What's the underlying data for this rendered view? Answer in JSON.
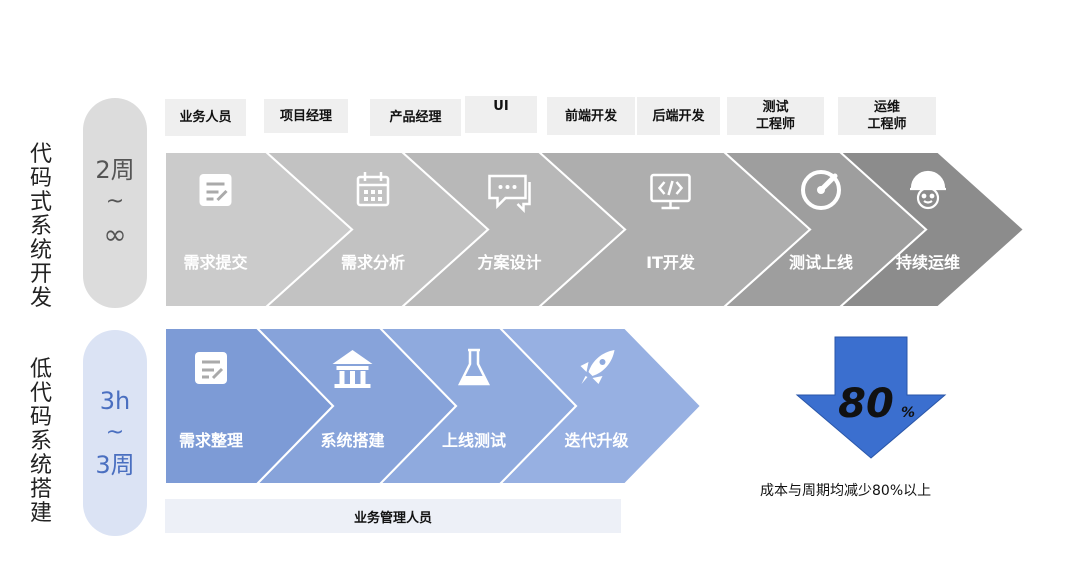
{
  "code_dev": {
    "label": "代码式系统开发",
    "period": {
      "top": "2周",
      "mid": "~",
      "bottom": "∞"
    },
    "roles": [
      "业务人员",
      "项目经理",
      "产品经理",
      "UI",
      "前端开发",
      "后端开发",
      "测试\n工程师",
      "运维\n工程师"
    ],
    "steps": [
      {
        "label": "需求提交",
        "icon": "form-icon",
        "color": "#cbcbcb"
      },
      {
        "label": "需求分析",
        "icon": "calendar-icon",
        "color": "#c2c2c2"
      },
      {
        "label": "方案设计",
        "icon": "chat-icon",
        "color": "#b8b8b8"
      },
      {
        "label": "IT开发",
        "icon": "code-monitor-icon",
        "color": "#aeaeae"
      },
      {
        "label": "测试上线",
        "icon": "gauge-icon",
        "color": "#9e9e9e"
      },
      {
        "label": "持续运维",
        "icon": "worker-helmet-icon",
        "color": "#8c8c8c"
      }
    ]
  },
  "lowcode": {
    "label": "低代码系统搭建",
    "period": {
      "top": "3h",
      "mid": "~",
      "bottom": "3周"
    },
    "steps": [
      {
        "label": "需求整理",
        "icon": "form-icon",
        "color": "#7d9bd6"
      },
      {
        "label": "系统搭建",
        "icon": "building-icon",
        "color": "#87a3da"
      },
      {
        "label": "上线测试",
        "icon": "flask-icon",
        "color": "#8faade"
      },
      {
        "label": "迭代升级",
        "icon": "rocket-icon",
        "color": "#97b0e2"
      }
    ],
    "manager": "业务管理人员"
  },
  "reduction": {
    "value": "80",
    "unit": "%",
    "note": "成本与周期均减少80%以上",
    "arrow_color": "#3b6fcf"
  }
}
